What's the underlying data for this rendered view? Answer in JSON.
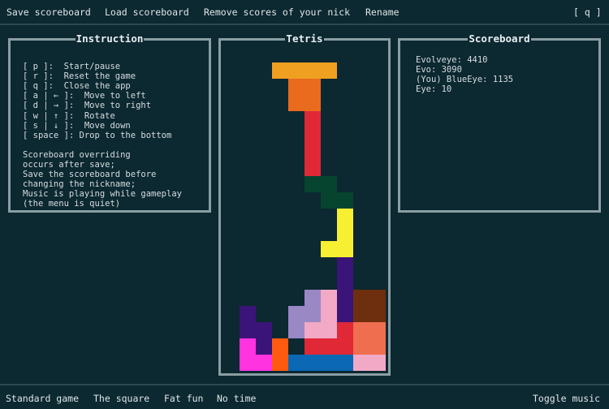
{
  "menu": {
    "save": "Save scoreboard",
    "load": "Load scoreboard",
    "remove": "Remove scores of your nick",
    "rename": "Rename",
    "quit": "[ q ]"
  },
  "instruction": {
    "title": "Instruction",
    "keys": [
      "[ p ]:  Start/pause",
      "[ r ]:  Reset the game",
      "[ q ]:  Close the app",
      "[ a | ← ]:  Move to left",
      "[ d | → ]:  Move to right",
      "[ w | ↑ ]:  Rotate",
      "[ s | ↓ ]:  Move down",
      "[ space ]: Drop to the bottom"
    ],
    "notes": [
      "Scoreboard overriding",
      "occurs after save;",
      "Save the scoreboard before",
      "changing the nickname;",
      "Music is playing while gameplay",
      "(the menu is quiet)"
    ]
  },
  "tetris": {
    "title": "Tetris"
  },
  "scoreboard": {
    "title": "Scoreboard",
    "entries": [
      "Evolveye: 4410",
      "Evo: 3090",
      "(You) BlueEye: 1135",
      "Eye: 10"
    ]
  },
  "footer": {
    "modes": [
      "Standard game",
      "The square",
      "Fat fun",
      "No time"
    ],
    "music": "Toggle music"
  },
  "colors": {
    "background": "#0c2831",
    "border": "#8a9ea3"
  },
  "board": {
    "cols": 10,
    "rows": 20,
    "cells": [
      {
        "c": 3,
        "r": 1,
        "color": "#f0a020"
      },
      {
        "c": 4,
        "r": 1,
        "color": "#f0a020"
      },
      {
        "c": 5,
        "r": 1,
        "color": "#f0a020"
      },
      {
        "c": 6,
        "r": 1,
        "color": "#f0a020"
      },
      {
        "c": 4,
        "r": 2,
        "color": "#ea6b1e"
      },
      {
        "c": 5,
        "r": 2,
        "color": "#ea6b1e"
      },
      {
        "c": 4,
        "r": 3,
        "color": "#ea6b1e"
      },
      {
        "c": 5,
        "r": 3,
        "color": "#ea6b1e"
      },
      {
        "c": 5,
        "r": 4,
        "color": "#e02836"
      },
      {
        "c": 5,
        "r": 5,
        "color": "#e02836"
      },
      {
        "c": 5,
        "r": 6,
        "color": "#e02836"
      },
      {
        "c": 5,
        "r": 7,
        "color": "#e02836"
      },
      {
        "c": 5,
        "r": 8,
        "color": "#064430"
      },
      {
        "c": 6,
        "r": 8,
        "color": "#064430"
      },
      {
        "c": 6,
        "r": 9,
        "color": "#064430"
      },
      {
        "c": 7,
        "r": 9,
        "color": "#064430"
      },
      {
        "c": 7,
        "r": 10,
        "color": "#f7f032"
      },
      {
        "c": 7,
        "r": 11,
        "color": "#f7f032"
      },
      {
        "c": 6,
        "r": 12,
        "color": "#f7f032"
      },
      {
        "c": 7,
        "r": 12,
        "color": "#f7f032"
      },
      {
        "c": 7,
        "r": 13,
        "color": "#3a1478"
      },
      {
        "c": 7,
        "r": 14,
        "color": "#3a1478"
      },
      {
        "c": 5,
        "r": 15,
        "color": "#9a88c4"
      },
      {
        "c": 6,
        "r": 15,
        "color": "#f2a9c6"
      },
      {
        "c": 7,
        "r": 15,
        "color": "#3a1478"
      },
      {
        "c": 8,
        "r": 15,
        "color": "#6e2f0e"
      },
      {
        "c": 9,
        "r": 15,
        "color": "#6e2f0e"
      },
      {
        "c": 1,
        "r": 16,
        "color": "#3a1478"
      },
      {
        "c": 4,
        "r": 16,
        "color": "#9a88c4"
      },
      {
        "c": 5,
        "r": 16,
        "color": "#9a88c4"
      },
      {
        "c": 6,
        "r": 16,
        "color": "#f2a9c6"
      },
      {
        "c": 7,
        "r": 16,
        "color": "#3a1478"
      },
      {
        "c": 8,
        "r": 16,
        "color": "#6e2f0e"
      },
      {
        "c": 9,
        "r": 16,
        "color": "#6e2f0e"
      },
      {
        "c": 1,
        "r": 17,
        "color": "#3a1478"
      },
      {
        "c": 2,
        "r": 17,
        "color": "#3a1478"
      },
      {
        "c": 4,
        "r": 17,
        "color": "#9a88c4"
      },
      {
        "c": 5,
        "r": 17,
        "color": "#f2a9c6"
      },
      {
        "c": 6,
        "r": 17,
        "color": "#f2a9c6"
      },
      {
        "c": 7,
        "r": 17,
        "color": "#e02836"
      },
      {
        "c": 8,
        "r": 17,
        "color": "#ef6e50"
      },
      {
        "c": 9,
        "r": 17,
        "color": "#ef6e50"
      },
      {
        "c": 1,
        "r": 18,
        "color": "#ff33e0"
      },
      {
        "c": 2,
        "r": 18,
        "color": "#3a1478"
      },
      {
        "c": 3,
        "r": 18,
        "color": "#ff5a10"
      },
      {
        "c": 5,
        "r": 18,
        "color": "#e02836"
      },
      {
        "c": 6,
        "r": 18,
        "color": "#e02836"
      },
      {
        "c": 7,
        "r": 18,
        "color": "#e02836"
      },
      {
        "c": 8,
        "r": 18,
        "color": "#ef6e50"
      },
      {
        "c": 9,
        "r": 18,
        "color": "#ef6e50"
      },
      {
        "c": 1,
        "r": 19,
        "color": "#ff33e0"
      },
      {
        "c": 2,
        "r": 19,
        "color": "#ff33e0"
      },
      {
        "c": 3,
        "r": 19,
        "color": "#ff5a10"
      },
      {
        "c": 4,
        "r": 19,
        "color": "#0a68b4"
      },
      {
        "c": 5,
        "r": 19,
        "color": "#0a68b4"
      },
      {
        "c": 6,
        "r": 19,
        "color": "#0a68b4"
      },
      {
        "c": 7,
        "r": 19,
        "color": "#0a68b4"
      },
      {
        "c": 8,
        "r": 19,
        "color": "#f2a9c6"
      },
      {
        "c": 9,
        "r": 19,
        "color": "#f2a9c6"
      }
    ]
  }
}
